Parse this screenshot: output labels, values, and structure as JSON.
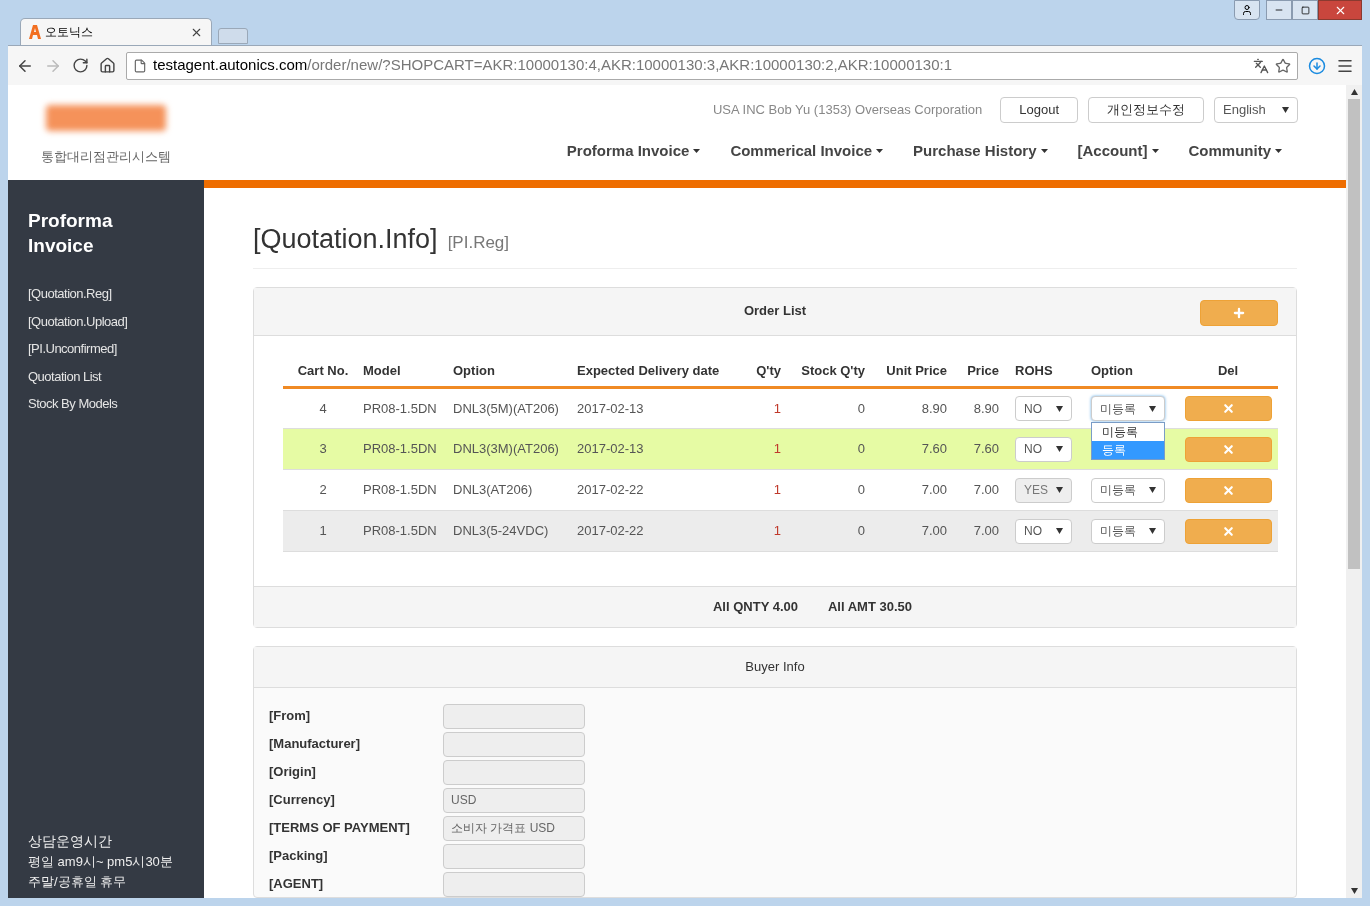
{
  "browser": {
    "tab_title": "오토닉스",
    "url_host": "testagent.autonics.com",
    "url_path": "/order/new/?SHOPCART=AKR:10000130:4,AKR:10000130:3,AKR:10000130:2,AKR:10000130:1"
  },
  "header": {
    "system_name": "통합대리점관리시스템",
    "user_info": "USA INC Bob Yu (1353) Overseas Corporation",
    "buttons": [
      "Logout",
      "개인정보수정"
    ],
    "language": "English",
    "nav": [
      "Proforma Invoice",
      "Commerical Invoice",
      "Purchase History",
      "[Account]",
      "Community"
    ]
  },
  "sidebar": {
    "title": "Proforma Invoice",
    "items": [
      "[Quotation.Reg]",
      "[Quotation.Upload]",
      "[PI.Unconfirmed]",
      "Quotation List",
      "Stock By Models"
    ],
    "hours_title": "상담운영시간",
    "hours": [
      "평일 am9시~ pm5시30분",
      "주말/공휴일 휴무"
    ]
  },
  "page": {
    "title": "[Quotation.Info]",
    "subtitle": "[PI.Reg]"
  },
  "order_list": {
    "title": "Order List",
    "columns": [
      "Cart No.",
      "Model",
      "Option",
      "Expected Delivery date",
      "Q'ty",
      "Stock Q'ty",
      "Unit Price",
      "Price",
      "ROHS",
      "Option",
      "Del"
    ],
    "rows": [
      {
        "cart_no": "4",
        "model": "PR08-1.5DN",
        "option": "DNL3(5M)(AT206)",
        "delivery": "2017-02-13",
        "qty": "1",
        "stock": "0",
        "unit_price": "8.90",
        "price": "8.90",
        "rohs": "NO",
        "rohs_disabled": false,
        "option_select": "미등록",
        "open": true,
        "highlighted": false,
        "shaded": false
      },
      {
        "cart_no": "3",
        "model": "PR08-1.5DN",
        "option": "DNL3(3M)(AT206)",
        "delivery": "2017-02-13",
        "qty": "1",
        "stock": "0",
        "unit_price": "7.60",
        "price": "7.60",
        "rohs": "NO",
        "rohs_disabled": false,
        "open": false,
        "highlighted": true
      },
      {
        "cart_no": "2",
        "model": "PR08-1.5DN",
        "option": "DNL3(AT206)",
        "delivery": "2017-02-22",
        "qty": "1",
        "stock": "0",
        "unit_price": "7.00",
        "price": "7.00",
        "rohs": "YES",
        "rohs_disabled": true,
        "option_select": "미등록",
        "open": false,
        "highlighted": false,
        "shaded": false
      },
      {
        "cart_no": "1",
        "model": "PR08-1.5DN",
        "option": "DNL3(5-24VDC)",
        "delivery": "2017-02-22",
        "qty": "1",
        "stock": "0",
        "unit_price": "7.00",
        "price": "7.00",
        "rohs": "NO",
        "rohs_disabled": false,
        "option_select": "미등록",
        "open": false,
        "highlighted": false,
        "shaded": true
      }
    ],
    "dropdown_options": [
      {
        "label": "미등록",
        "selected": false
      },
      {
        "label": "등록",
        "selected": true
      }
    ],
    "totals": [
      "All QNTY 4.00",
      "All AMT 30.50"
    ]
  },
  "buyer_info": {
    "title": "Buyer Info",
    "fields": [
      {
        "label": "[From]"
      },
      {
        "label": "[Manufacturer]"
      },
      {
        "label": "[Origin]"
      },
      {
        "label": "[Currency]",
        "value": "USD"
      },
      {
        "label": "[TERMS OF PAYMENT]",
        "value": "소비자 가격표 USD"
      },
      {
        "label": "[Packing]"
      },
      {
        "label": "[AGENT]"
      }
    ]
  }
}
